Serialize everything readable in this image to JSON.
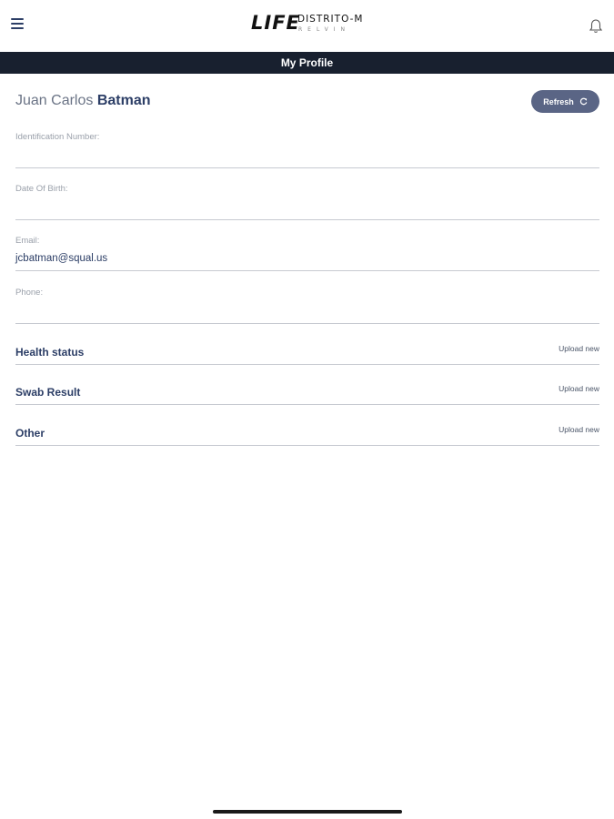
{
  "header": {
    "logo": {
      "life": "LIFE",
      "distrito": "DISTRITO-M",
      "sub": "RELVIN"
    },
    "title": "My Profile"
  },
  "profile": {
    "first_names": "Juan Carlos",
    "last_name": "Batman",
    "refresh_label": "Refresh"
  },
  "fields": [
    {
      "label": "Identification Number:",
      "value": ""
    },
    {
      "label": "Date Of Birth:",
      "value": ""
    },
    {
      "label": "Email:",
      "value": "jcbatman@squal.us"
    },
    {
      "label": "Phone:",
      "value": ""
    }
  ],
  "uploads": [
    {
      "title": "Health status",
      "action": "Upload new"
    },
    {
      "title": "Swab Result",
      "action": "Upload new"
    },
    {
      "title": "Other",
      "action": "Upload new"
    }
  ],
  "colors": {
    "title_bar": "#18202f",
    "accent": "#2c3e66",
    "button": "#5a6585"
  }
}
